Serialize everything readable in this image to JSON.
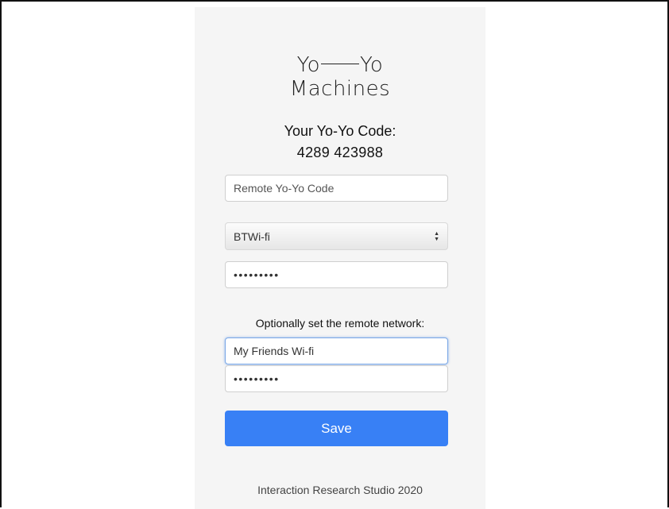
{
  "logo": {
    "line1_left": "Yo",
    "line1_right": "Yo",
    "line2": "Machines"
  },
  "code": {
    "label": "Your Yo-Yo Code:",
    "value": "4289 423988"
  },
  "remote_code": {
    "placeholder": "Remote Yo-Yo Code",
    "value": ""
  },
  "local_network": {
    "selected": "BTWi-fi",
    "password_mask": "•••••••••"
  },
  "remote_network": {
    "label": "Optionally set the remote network:",
    "ssid_value": "My Friends Wi-fi",
    "password_mask": "•••••••••"
  },
  "save_label": "Save",
  "footer": "Interaction Research Studio 2020",
  "colors": {
    "accent": "#3880f5",
    "panel_bg": "#f5f5f5"
  }
}
